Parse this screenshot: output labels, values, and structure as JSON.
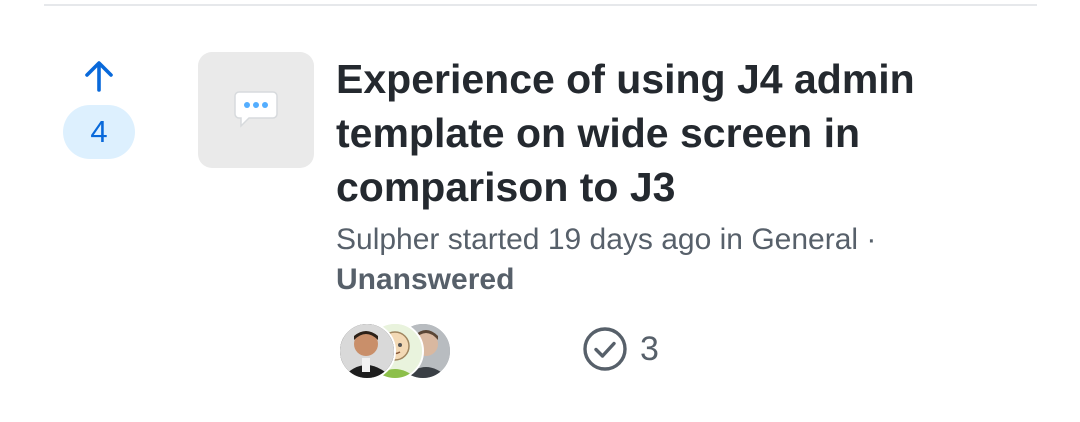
{
  "discussion": {
    "votes": "4",
    "title": "Experience of using J4 admin template on wide screen in comparison to J3",
    "author": "Sulpher",
    "started_text": "started",
    "time_ago": "19 days ago",
    "in_text": "in",
    "category": "General",
    "separator": "·",
    "status": "Unanswered",
    "answer_count": "3",
    "participants": [
      "participant-1",
      "participant-2",
      "participant-3"
    ]
  },
  "colors": {
    "accent": "#0969da",
    "vote_pill_bg": "#ddf0fe",
    "title": "#24292f",
    "muted": "#57606a",
    "category_bg": "#eaeaea",
    "category_icon": "#54aeff"
  },
  "icons": {
    "upvote": "arrow-up-icon",
    "category": "speech-bubble-icon",
    "answers": "check-circle-icon"
  }
}
